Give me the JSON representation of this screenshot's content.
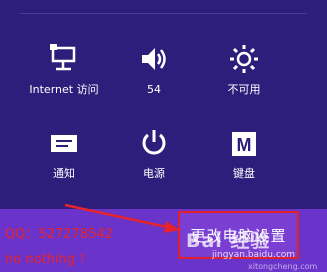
{
  "tiles": [
    {
      "label": "Internet 访问",
      "icon": "network-icon"
    },
    {
      "label": "54",
      "icon": "speaker-volume-icon"
    },
    {
      "label": "不可用",
      "icon": "brightness-icon"
    },
    {
      "label": "通知",
      "icon": "notifications-icon"
    },
    {
      "label": "电源",
      "icon": "power-icon"
    },
    {
      "label": "键盘",
      "icon": "keyboard-icon"
    }
  ],
  "annotation": {
    "qq": "QQ：527278542",
    "note": "no nothing ！"
  },
  "change_pc_settings": {
    "label": "更改电脑设置"
  },
  "watermark": {
    "text": "经验",
    "brand": "Bai",
    "site": "jingyan.baidu.com",
    "site2": "xitongcheng.com"
  },
  "colors": {
    "background": "#2d1e7b",
    "bottom_bar": "#6a33c9",
    "highlight": "#e0202a",
    "annotation_text": "#e8232a"
  }
}
